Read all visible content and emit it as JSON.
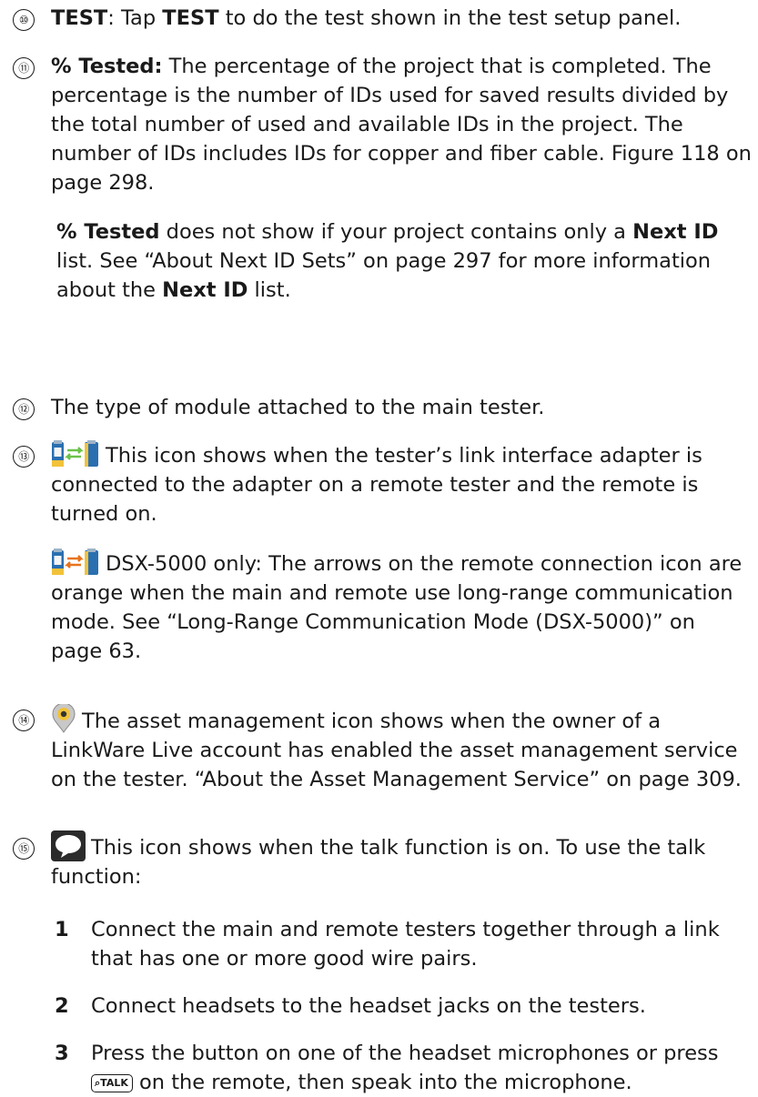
{
  "items": [
    {
      "num": "⑩",
      "term": "TEST",
      "pre": ": Tap ",
      "term2": "TEST",
      "post": " to do the test shown in the test setup panel."
    },
    {
      "num": "⑪",
      "term": "% Tested:",
      "text": " The percentage of the project that is completed. The percentage is the number of IDs used for saved results divided by the total number of used and available IDs in the project. The number of IDs includes IDs for copper and fiber cable. Figure 118 on page 298.",
      "p2_term": "% Tested",
      "p2_a": " does not show if your project contains only a ",
      "p2_term2": "Next ID",
      "p2_b": " list. See “About Next ID Sets” on page 297 for more information about the ",
      "p2_term3": "Next ID",
      "p2_c": " list."
    },
    {
      "num": "⑫",
      "text": "The type of module attached to the main tester."
    },
    {
      "num": "⑬",
      "text": "This icon shows when the tester’s link interface adapter is connected to the adapter on a remote tester and the remote is turned on.",
      "icon": "remote-connected-icon",
      "p2": "DSX-5000 only: The arrows on the remote connection icon are orange when the main and remote use long-range communication mode. See “Long-Range Communication Mode (DSX-5000)” on page 63.",
      "icon2": "remote-long-range-icon"
    },
    {
      "num": "⑭",
      "text": "The asset management icon shows when the owner of a LinkWare Live account has enabled the asset management service on the tester. “About the Asset Management Service” on page 309.",
      "icon": "asset-management-icon"
    },
    {
      "num": "⑮",
      "text": "This icon shows when the talk function is on. To use the talk function:",
      "icon": "talk-bubble-icon",
      "steps": [
        {
          "n": "1",
          "text": "Connect the main and remote testers together through a link that has one or more good wire pairs."
        },
        {
          "n": "2",
          "text": "Connect headsets to the headset jacks on the testers."
        },
        {
          "n": "3",
          "pre": "Press the button on one of the headset microphones or press ",
          "key": "TALK",
          "post": " on the remote, then speak into the microphone."
        }
      ]
    }
  ],
  "colors": {
    "text": "#1a1a1a",
    "arrow_green": "#6cc24a",
    "arrow_orange": "#e8731c",
    "tester_blue": "#2a6fb0",
    "tester_yellow": "#f2c23a"
  }
}
